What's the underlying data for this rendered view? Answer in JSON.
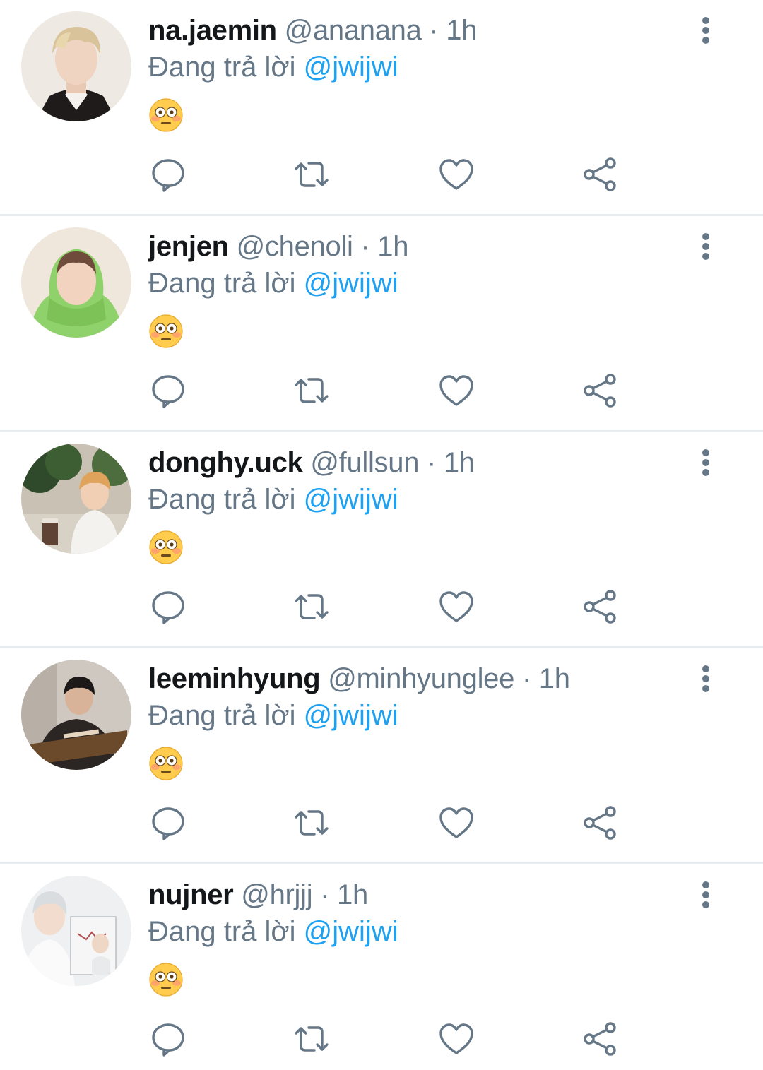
{
  "colors": {
    "name": "#14171a",
    "secondary": "#657786",
    "link": "#1da1f2",
    "divider": "#e6ecf0",
    "icon": "#657786"
  },
  "tweets": [
    {
      "name": "na.jaemin",
      "handle": "@ananana",
      "dot": "·",
      "time": "1h",
      "reply_prefix": "Đang trả lời",
      "reply_to": "@jwijwi",
      "emoji": "flushed-face",
      "avatar_icon": "profile-photo"
    },
    {
      "name": "jenjen",
      "handle": "@chenoli",
      "dot": "·",
      "time": "1h",
      "reply_prefix": "Đang trả lời",
      "reply_to": "@jwijwi",
      "emoji": "flushed-face",
      "avatar_icon": "profile-photo"
    },
    {
      "name": "donghy.uck",
      "handle": "@fullsun",
      "dot": "·",
      "time": "1h",
      "reply_prefix": "Đang trả lời",
      "reply_to": "@jwijwi",
      "emoji": "flushed-face",
      "avatar_icon": "profile-photo"
    },
    {
      "name": "leeminhyung",
      "handle": "@minhyunglee",
      "dot": "·",
      "time": "1h",
      "reply_prefix": "Đang trả lời",
      "reply_to": "@jwijwi",
      "emoji": "flushed-face",
      "avatar_icon": "profile-photo"
    },
    {
      "name": "nujner",
      "handle": "@hrjjj",
      "dot": "·",
      "time": "1h",
      "reply_prefix": "Đang trả lời",
      "reply_to": "@jwijwi",
      "emoji": "flushed-face",
      "avatar_icon": "profile-photo"
    }
  ],
  "actions": {
    "reply_icon": "reply-icon",
    "retweet_icon": "retweet-icon",
    "like_icon": "like-icon",
    "share_icon": "share-icon",
    "more_icon": "more-vertical-icon"
  }
}
